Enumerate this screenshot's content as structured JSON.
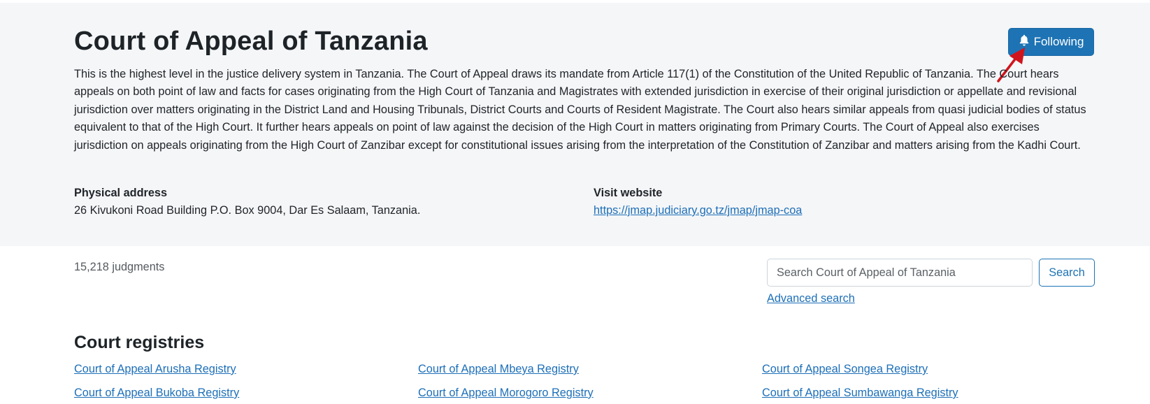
{
  "header": {
    "title": "Court of Appeal of Tanzania",
    "follow_label": "Following",
    "follow_icon": "bell-icon",
    "description": "This is the highest level in the justice delivery system in Tanzania. The Court of Appeal draws its mandate from Article 117(1) of the Constitution of the United Republic of Tanzania. The Court hears appeals  on both point of law and facts for cases originating from the High Court of Tanzania and Magistrates with extended jurisdiction in exercise of their original jurisdiction or appellate and revisional jurisdiction over matters originating in the District Land and Housing Tribunals, District Courts and Courts of Resident Magistrate. The Court also hears similar appeals  from quasi judicial bodies of status equivalent to that of the High Court. It  further hears appeals  on point of law against the decision of the High Court in  matters originating from Primary Courts. The Court of Appeal also exercises jurisdiction on appeals originating from the High Court of Zanzibar except for constitutional issues arising from the interpretation of the Constitution of Zanzibar and matters arising from the Kadhi Court.",
    "address_label": "Physical address",
    "address_value": "26 Kivukoni Road Building P.O. Box 9004, Dar Es Salaam, Tanzania.",
    "website_label": "Visit website",
    "website_url": "https://jmap.judiciary.go.tz/jmap/jmap-coa"
  },
  "results": {
    "count_text": "15,218 judgments"
  },
  "search": {
    "placeholder": "Search Court of Appeal of Tanzania",
    "button_label": "Search",
    "advanced_label": "Advanced search"
  },
  "registries": {
    "heading": "Court registries",
    "items": [
      "Court of Appeal Arusha Registry",
      "Court of Appeal Mbeya Registry",
      "Court of Appeal Songea Registry",
      "Court of Appeal Bukoba Registry",
      "Court of Appeal Morogoro Registry",
      "Court of Appeal Sumbawanga Registry"
    ]
  },
  "colors": {
    "hero_bg": "#f5f6f8",
    "primary": "#1d73b4",
    "link": "#1d6fb8",
    "annotation_arrow": "#d0141c"
  }
}
